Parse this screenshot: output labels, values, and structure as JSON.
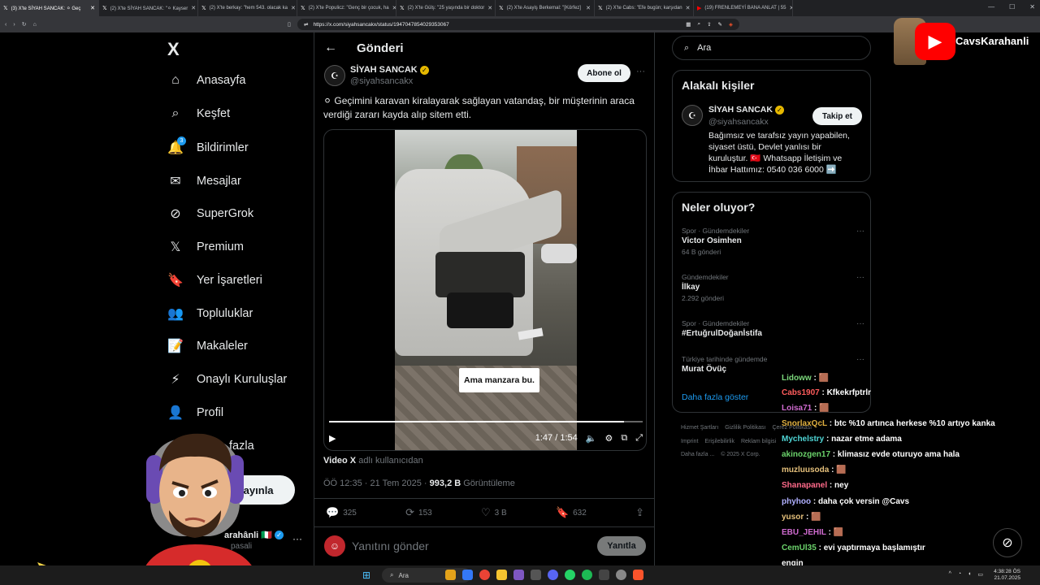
{
  "browser": {
    "tabs": [
      {
        "label": "(3) X'te SİYAH SANCAK: ⚪ Geç",
        "active": true
      },
      {
        "label": "(2) X'te SİYAH SANCAK: \"⚪ Kayser",
        "active": false
      },
      {
        "label": "(2) X'te berkay: \"hem 543. olacak ka",
        "active": false
      },
      {
        "label": "(2) X'te Populicz: \"Genç bir çocuk, ha",
        "active": false
      },
      {
        "label": "(2) X'te Gülş: \"25 yaşında bir doktor",
        "active": false
      },
      {
        "label": "(2) X'te Asayiş Berkemal: \"[Körfez]",
        "active": false
      },
      {
        "label": "(2) X'te Cabs: \"Efe bugün; karşıdan",
        "active": false
      },
      {
        "label": "(19) FRENLEMEYİ BANA ANLAT | 55",
        "active": false
      }
    ],
    "url": "https://x.com/siyahsancakx/status/1947047854029353067"
  },
  "nav": {
    "logo": "X",
    "items": [
      {
        "label": "Anasayfa",
        "icon": "home-icon"
      },
      {
        "label": "Keşfet",
        "icon": "search-icon"
      },
      {
        "label": "Bildirimler",
        "icon": "bell-icon",
        "badge": "3"
      },
      {
        "label": "Mesajlar",
        "icon": "mail-icon"
      },
      {
        "label": "SuperGrok",
        "icon": "grok-icon"
      },
      {
        "label": "Premium",
        "icon": "x-icon"
      },
      {
        "label": "Yer İşaretleri",
        "icon": "bookmark-icon"
      },
      {
        "label": "Topluluklar",
        "icon": "people-icon"
      },
      {
        "label": "Makaleler",
        "icon": "article-icon"
      },
      {
        "label": "Onaylı Kuruluşlar",
        "icon": "lightning-icon"
      },
      {
        "label": "Profil",
        "icon": "person-icon"
      },
      {
        "label": "fazla",
        "icon": "more-icon"
      }
    ],
    "post_button": "yayınla",
    "account_name": "arahânli 🇮🇹",
    "account_handle": "pasali"
  },
  "post": {
    "header": "Gönderi",
    "author_name": "SİYAH SANCAK",
    "author_handle": "@siyahsancakx",
    "follow_label": "Abone ol",
    "text": "⚪ Geçimini karavan kiralayarak sağlayan vatandaş, bir müşterinin araca verdiği zararı kayda alıp sitem etti.",
    "video_subtitle": "Ama manzara bu.",
    "video_time": "1:47 / 1:54",
    "video_progress": 0.94,
    "video_source_bold": "Video X",
    "video_source_rest": " adlı kullanıcıdan",
    "timestamp": "ÖÖ 12:35 · 21 Tem 2025 · ",
    "views_count": "993,2 B",
    "views_label": " Görüntüleme",
    "replies": "325",
    "reposts": "153",
    "likes": "3 B",
    "bookmarks": "632",
    "reply_placeholder": "Yanıtını gönder",
    "reply_button": "Yanıtla"
  },
  "right": {
    "search_placeholder": "Ara",
    "related_title": "Alakalı kişiler",
    "related_name": "SİYAH SANCAK",
    "related_handle": "@siyahsancakx",
    "related_follow": "Takip et",
    "related_bio": "Bağımsız ve tarafsız yayın yapabilen, siyaset üstü, Devlet yanlısı bir kuruluştur. 🇹🇷 Whatsapp İletişim ve İhbar Hattımız: 0540 036 6000 ➡️",
    "trends_title": "Neler oluyor?",
    "trends": [
      {
        "category": "Spor · Gündemdekiler",
        "title": "Victor Osimhen",
        "count": "64 B gönderi"
      },
      {
        "category": "Gündemdekiler",
        "title": "İlkay",
        "count": "2.292 gönderi"
      },
      {
        "category": "Spor · Gündemdekiler",
        "title": "#ErtuğrulDoğanİstifa",
        "count": ""
      },
      {
        "category": "Türkiye tarihinde gündemde",
        "title": "Murat Övüç",
        "count": ""
      }
    ],
    "show_more": "Daha fazla göster",
    "footer1": [
      "Hizmet Şartları",
      "Gizlilik Politikası",
      "Çerez Politikası"
    ],
    "footer2": [
      "Imprint",
      "Erişilebilirlik",
      "Reklam bilgisi"
    ],
    "footer3": [
      "Daha fazla ...",
      "© 2025 X Corp."
    ]
  },
  "overlay": {
    "brand": "CavsKarahanli",
    "chat": [
      {
        "user": "Lidoww",
        "msg": " : 🟫",
        "color": "#7bd77b"
      },
      {
        "user": "Cabs1907",
        "msg": " : Kfkekrfptrlr",
        "color": "#ff5c5c"
      },
      {
        "user": "Loisa71",
        "msg": " : 🟫",
        "color": "#d06bd0"
      },
      {
        "user": "SnorlaxQcL",
        "msg": " : btc %10 artınca herkese %10 artıyo kanka",
        "color": "#e0b040"
      },
      {
        "user": "Mychelstry",
        "msg": " : nazar etme adama",
        "color": "#4fd6d6"
      },
      {
        "user": "akinozgen17",
        "msg": " : klimasız evde oturuyo ama hala",
        "color": "#6bd36b"
      },
      {
        "user": "muzluusoda",
        "msg": " : 🟫",
        "color": "#e5c07b"
      },
      {
        "user": "Shanapanel",
        "msg": " : ney",
        "color": "#ff6a8a"
      },
      {
        "user": "phyhoo",
        "msg": " : daha çok versin @Cavs",
        "color": "#b0b0ff"
      },
      {
        "user": "yusor",
        "msg": " : 🟫",
        "color": "#e5c07b"
      },
      {
        "user": "EBU_JEHIL",
        "msg": " : 🟫",
        "color": "#d06bd0"
      },
      {
        "user": "CemUl35",
        "msg": " : evi yaptırmaya başlamıştır",
        "color": "#6bd36b"
      },
      {
        "user": "engin",
        "msg": "",
        "color": "#ffffff"
      }
    ]
  },
  "taskbar": {
    "search": "Ara",
    "time": "4:38:28 ÖS",
    "date": "21.07.2025"
  },
  "colors": {
    "accent": "#1d9bf0",
    "background": "#000000",
    "border": "#2f3336",
    "muted": "#71767b"
  }
}
